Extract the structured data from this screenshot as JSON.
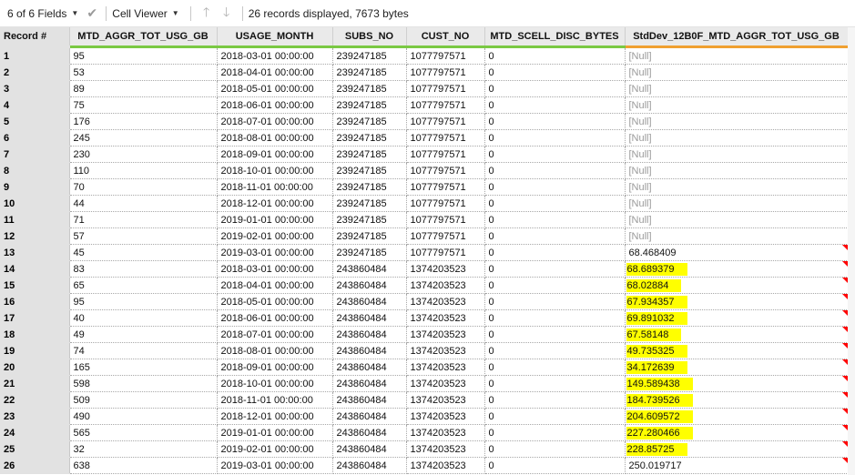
{
  "toolbar": {
    "fields_label": "6 of 6 Fields",
    "viewer_label": "Cell Viewer",
    "status": "26 records displayed, 7673 bytes"
  },
  "colors": {
    "highlight": "#ffff00",
    "flag": "#ff0000",
    "header_text_col": "#7ac943",
    "header_num_col": "#f0a030"
  },
  "columns": [
    "Record #",
    "MTD_AGGR_TOT_USG_GB",
    "USAGE_MONTH",
    "SUBS_NO",
    "CUST_NO",
    "MTD_SCELL_DISC_BYTES",
    "StdDev_12B0F_MTD_AGGR_TOT_USG_GB"
  ],
  "rows": [
    {
      "rec": "1",
      "gb": "95",
      "month": "2018-03-01 00:00:00",
      "subs": "239247185",
      "cust": "1077797571",
      "disc": "0",
      "std": "[Null]",
      "null": true,
      "hl": false,
      "flag": false
    },
    {
      "rec": "2",
      "gb": "53",
      "month": "2018-04-01 00:00:00",
      "subs": "239247185",
      "cust": "1077797571",
      "disc": "0",
      "std": "[Null]",
      "null": true,
      "hl": false,
      "flag": false
    },
    {
      "rec": "3",
      "gb": "89",
      "month": "2018-05-01 00:00:00",
      "subs": "239247185",
      "cust": "1077797571",
      "disc": "0",
      "std": "[Null]",
      "null": true,
      "hl": false,
      "flag": false
    },
    {
      "rec": "4",
      "gb": "75",
      "month": "2018-06-01 00:00:00",
      "subs": "239247185",
      "cust": "1077797571",
      "disc": "0",
      "std": "[Null]",
      "null": true,
      "hl": false,
      "flag": false
    },
    {
      "rec": "5",
      "gb": "176",
      "month": "2018-07-01 00:00:00",
      "subs": "239247185",
      "cust": "1077797571",
      "disc": "0",
      "std": "[Null]",
      "null": true,
      "hl": false,
      "flag": false
    },
    {
      "rec": "6",
      "gb": "245",
      "month": "2018-08-01 00:00:00",
      "subs": "239247185",
      "cust": "1077797571",
      "disc": "0",
      "std": "[Null]",
      "null": true,
      "hl": false,
      "flag": false
    },
    {
      "rec": "7",
      "gb": "230",
      "month": "2018-09-01 00:00:00",
      "subs": "239247185",
      "cust": "1077797571",
      "disc": "0",
      "std": "[Null]",
      "null": true,
      "hl": false,
      "flag": false
    },
    {
      "rec": "8",
      "gb": "110",
      "month": "2018-10-01 00:00:00",
      "subs": "239247185",
      "cust": "1077797571",
      "disc": "0",
      "std": "[Null]",
      "null": true,
      "hl": false,
      "flag": false
    },
    {
      "rec": "9",
      "gb": "70",
      "month": "2018-11-01 00:00:00",
      "subs": "239247185",
      "cust": "1077797571",
      "disc": "0",
      "std": "[Null]",
      "null": true,
      "hl": false,
      "flag": false
    },
    {
      "rec": "10",
      "gb": "44",
      "month": "2018-12-01 00:00:00",
      "subs": "239247185",
      "cust": "1077797571",
      "disc": "0",
      "std": "[Null]",
      "null": true,
      "hl": false,
      "flag": false
    },
    {
      "rec": "11",
      "gb": "71",
      "month": "2019-01-01 00:00:00",
      "subs": "239247185",
      "cust": "1077797571",
      "disc": "0",
      "std": "[Null]",
      "null": true,
      "hl": false,
      "flag": false
    },
    {
      "rec": "12",
      "gb": "57",
      "month": "2019-02-01 00:00:00",
      "subs": "239247185",
      "cust": "1077797571",
      "disc": "0",
      "std": "[Null]",
      "null": true,
      "hl": false,
      "flag": false
    },
    {
      "rec": "13",
      "gb": "45",
      "month": "2019-03-01 00:00:00",
      "subs": "239247185",
      "cust": "1077797571",
      "disc": "0",
      "std": "68.468409",
      "null": false,
      "hl": false,
      "flag": true
    },
    {
      "rec": "14",
      "gb": "83",
      "month": "2018-03-01 00:00:00",
      "subs": "243860484",
      "cust": "1374203523",
      "disc": "0",
      "std": "68.689379",
      "null": false,
      "hl": true,
      "flag": true
    },
    {
      "rec": "15",
      "gb": "65",
      "month": "2018-04-01 00:00:00",
      "subs": "243860484",
      "cust": "1374203523",
      "disc": "0",
      "std": "68.02884",
      "null": false,
      "hl": true,
      "flag": true
    },
    {
      "rec": "16",
      "gb": "95",
      "month": "2018-05-01 00:00:00",
      "subs": "243860484",
      "cust": "1374203523",
      "disc": "0",
      "std": "67.934357",
      "null": false,
      "hl": true,
      "flag": true
    },
    {
      "rec": "17",
      "gb": "40",
      "month": "2018-06-01 00:00:00",
      "subs": "243860484",
      "cust": "1374203523",
      "disc": "0",
      "std": "69.891032",
      "null": false,
      "hl": true,
      "flag": true
    },
    {
      "rec": "18",
      "gb": "49",
      "month": "2018-07-01 00:00:00",
      "subs": "243860484",
      "cust": "1374203523",
      "disc": "0",
      "std": "67.58148",
      "null": false,
      "hl": true,
      "flag": true
    },
    {
      "rec": "19",
      "gb": "74",
      "month": "2018-08-01 00:00:00",
      "subs": "243860484",
      "cust": "1374203523",
      "disc": "0",
      "std": "49.735325",
      "null": false,
      "hl": true,
      "flag": true
    },
    {
      "rec": "20",
      "gb": "165",
      "month": "2018-09-01 00:00:00",
      "subs": "243860484",
      "cust": "1374203523",
      "disc": "0",
      "std": "34.172639",
      "null": false,
      "hl": true,
      "flag": true
    },
    {
      "rec": "21",
      "gb": "598",
      "month": "2018-10-01 00:00:00",
      "subs": "243860484",
      "cust": "1374203523",
      "disc": "0",
      "std": "149.589438",
      "null": false,
      "hl": true,
      "flag": true
    },
    {
      "rec": "22",
      "gb": "509",
      "month": "2018-11-01 00:00:00",
      "subs": "243860484",
      "cust": "1374203523",
      "disc": "0",
      "std": "184.739526",
      "null": false,
      "hl": true,
      "flag": true
    },
    {
      "rec": "23",
      "gb": "490",
      "month": "2018-12-01 00:00:00",
      "subs": "243860484",
      "cust": "1374203523",
      "disc": "0",
      "std": "204.609572",
      "null": false,
      "hl": true,
      "flag": true
    },
    {
      "rec": "24",
      "gb": "565",
      "month": "2019-01-01 00:00:00",
      "subs": "243860484",
      "cust": "1374203523",
      "disc": "0",
      "std": "227.280466",
      "null": false,
      "hl": true,
      "flag": true
    },
    {
      "rec": "25",
      "gb": "32",
      "month": "2019-02-01 00:00:00",
      "subs": "243860484",
      "cust": "1374203523",
      "disc": "0",
      "std": "228.85725",
      "null": false,
      "hl": true,
      "flag": true
    },
    {
      "rec": "26",
      "gb": "638",
      "month": "2019-03-01 00:00:00",
      "subs": "243860484",
      "cust": "1374203523",
      "disc": "0",
      "std": "250.019717",
      "null": false,
      "hl": false,
      "flag": true
    }
  ]
}
